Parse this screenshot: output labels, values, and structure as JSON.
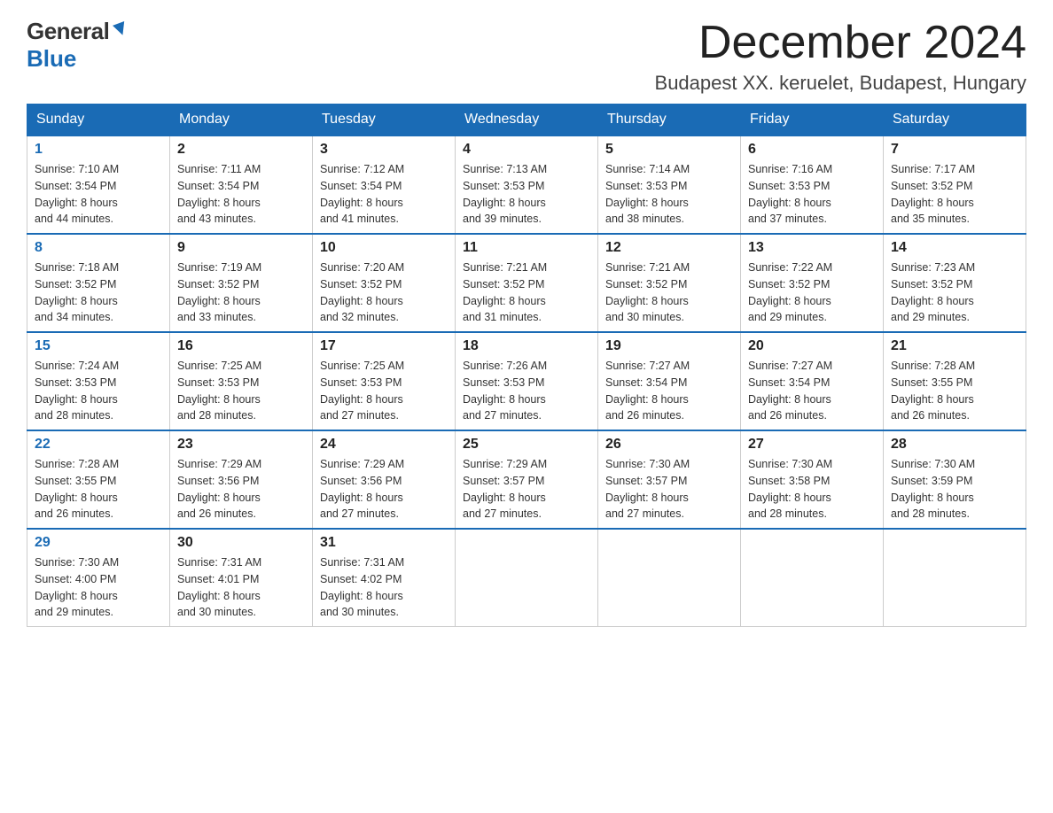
{
  "header": {
    "logo_general": "General",
    "logo_blue": "Blue",
    "month_title": "December 2024",
    "location": "Budapest XX. keruelet, Budapest, Hungary"
  },
  "weekdays": [
    "Sunday",
    "Monday",
    "Tuesday",
    "Wednesday",
    "Thursday",
    "Friday",
    "Saturday"
  ],
  "weeks": [
    [
      {
        "day": "1",
        "sunrise": "7:10 AM",
        "sunset": "3:54 PM",
        "daylight": "8 hours and 44 minutes."
      },
      {
        "day": "2",
        "sunrise": "7:11 AM",
        "sunset": "3:54 PM",
        "daylight": "8 hours and 43 minutes."
      },
      {
        "day": "3",
        "sunrise": "7:12 AM",
        "sunset": "3:54 PM",
        "daylight": "8 hours and 41 minutes."
      },
      {
        "day": "4",
        "sunrise": "7:13 AM",
        "sunset": "3:53 PM",
        "daylight": "8 hours and 39 minutes."
      },
      {
        "day": "5",
        "sunrise": "7:14 AM",
        "sunset": "3:53 PM",
        "daylight": "8 hours and 38 minutes."
      },
      {
        "day": "6",
        "sunrise": "7:16 AM",
        "sunset": "3:53 PM",
        "daylight": "8 hours and 37 minutes."
      },
      {
        "day": "7",
        "sunrise": "7:17 AM",
        "sunset": "3:52 PM",
        "daylight": "8 hours and 35 minutes."
      }
    ],
    [
      {
        "day": "8",
        "sunrise": "7:18 AM",
        "sunset": "3:52 PM",
        "daylight": "8 hours and 34 minutes."
      },
      {
        "day": "9",
        "sunrise": "7:19 AM",
        "sunset": "3:52 PM",
        "daylight": "8 hours and 33 minutes."
      },
      {
        "day": "10",
        "sunrise": "7:20 AM",
        "sunset": "3:52 PM",
        "daylight": "8 hours and 32 minutes."
      },
      {
        "day": "11",
        "sunrise": "7:21 AM",
        "sunset": "3:52 PM",
        "daylight": "8 hours and 31 minutes."
      },
      {
        "day": "12",
        "sunrise": "7:21 AM",
        "sunset": "3:52 PM",
        "daylight": "8 hours and 30 minutes."
      },
      {
        "day": "13",
        "sunrise": "7:22 AM",
        "sunset": "3:52 PM",
        "daylight": "8 hours and 29 minutes."
      },
      {
        "day": "14",
        "sunrise": "7:23 AM",
        "sunset": "3:52 PM",
        "daylight": "8 hours and 29 minutes."
      }
    ],
    [
      {
        "day": "15",
        "sunrise": "7:24 AM",
        "sunset": "3:53 PM",
        "daylight": "8 hours and 28 minutes."
      },
      {
        "day": "16",
        "sunrise": "7:25 AM",
        "sunset": "3:53 PM",
        "daylight": "8 hours and 28 minutes."
      },
      {
        "day": "17",
        "sunrise": "7:25 AM",
        "sunset": "3:53 PM",
        "daylight": "8 hours and 27 minutes."
      },
      {
        "day": "18",
        "sunrise": "7:26 AM",
        "sunset": "3:53 PM",
        "daylight": "8 hours and 27 minutes."
      },
      {
        "day": "19",
        "sunrise": "7:27 AM",
        "sunset": "3:54 PM",
        "daylight": "8 hours and 26 minutes."
      },
      {
        "day": "20",
        "sunrise": "7:27 AM",
        "sunset": "3:54 PM",
        "daylight": "8 hours and 26 minutes."
      },
      {
        "day": "21",
        "sunrise": "7:28 AM",
        "sunset": "3:55 PM",
        "daylight": "8 hours and 26 minutes."
      }
    ],
    [
      {
        "day": "22",
        "sunrise": "7:28 AM",
        "sunset": "3:55 PM",
        "daylight": "8 hours and 26 minutes."
      },
      {
        "day": "23",
        "sunrise": "7:29 AM",
        "sunset": "3:56 PM",
        "daylight": "8 hours and 26 minutes."
      },
      {
        "day": "24",
        "sunrise": "7:29 AM",
        "sunset": "3:56 PM",
        "daylight": "8 hours and 27 minutes."
      },
      {
        "day": "25",
        "sunrise": "7:29 AM",
        "sunset": "3:57 PM",
        "daylight": "8 hours and 27 minutes."
      },
      {
        "day": "26",
        "sunrise": "7:30 AM",
        "sunset": "3:57 PM",
        "daylight": "8 hours and 27 minutes."
      },
      {
        "day": "27",
        "sunrise": "7:30 AM",
        "sunset": "3:58 PM",
        "daylight": "8 hours and 28 minutes."
      },
      {
        "day": "28",
        "sunrise": "7:30 AM",
        "sunset": "3:59 PM",
        "daylight": "8 hours and 28 minutes."
      }
    ],
    [
      {
        "day": "29",
        "sunrise": "7:30 AM",
        "sunset": "4:00 PM",
        "daylight": "8 hours and 29 minutes."
      },
      {
        "day": "30",
        "sunrise": "7:31 AM",
        "sunset": "4:01 PM",
        "daylight": "8 hours and 30 minutes."
      },
      {
        "day": "31",
        "sunrise": "7:31 AM",
        "sunset": "4:02 PM",
        "daylight": "8 hours and 30 minutes."
      },
      null,
      null,
      null,
      null
    ]
  ],
  "labels": {
    "sunrise": "Sunrise:",
    "sunset": "Sunset:",
    "daylight": "Daylight:"
  }
}
